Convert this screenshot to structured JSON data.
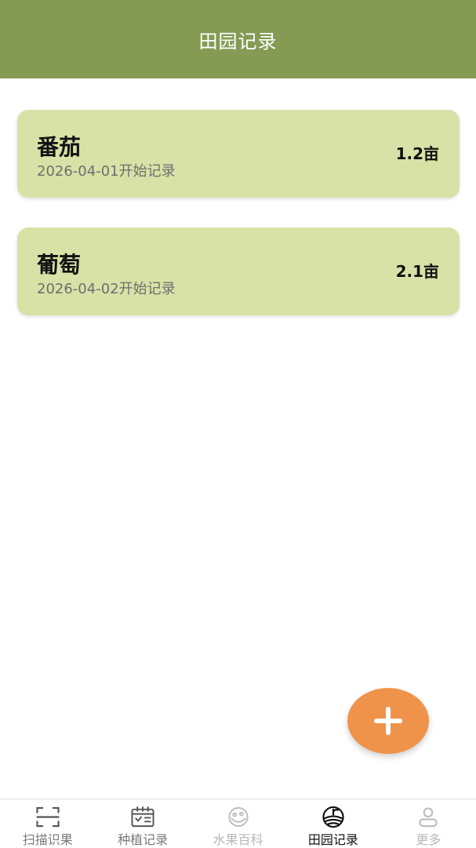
{
  "header": {
    "title": "田园记录"
  },
  "records": [
    {
      "name": "番茄",
      "date": "2026-04-01开始记录",
      "area": "1.2亩"
    },
    {
      "name": "葡萄",
      "date": "2026-04-02开始记录",
      "area": "2.1亩"
    }
  ],
  "fab": {
    "icon": "plus-icon"
  },
  "nav": {
    "items": [
      {
        "label": "扫描识果",
        "icon": "scan-icon"
      },
      {
        "label": "种植记录",
        "icon": "calendar-icon"
      },
      {
        "label": "水果百科",
        "icon": "fruit-icon"
      },
      {
        "label": "田园记录",
        "icon": "field-icon",
        "active": true
      },
      {
        "label": "更多",
        "icon": "user-icon"
      }
    ]
  },
  "colors": {
    "header": "#859b54",
    "card": "#d8e2a7",
    "fab": "#f0934a"
  }
}
